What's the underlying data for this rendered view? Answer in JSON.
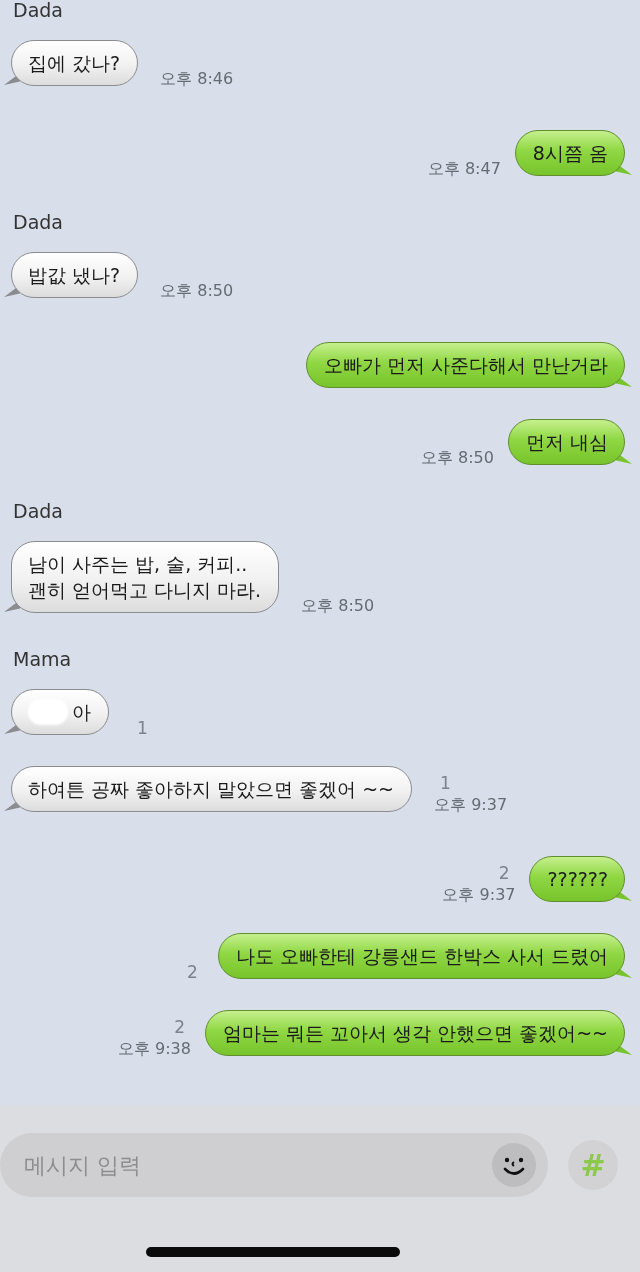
{
  "messages": [
    {
      "kind": "sender",
      "name": "Dada"
    },
    {
      "kind": "incoming",
      "text": "집에 갔나?",
      "time": "오후 8:46"
    },
    {
      "kind": "outgoing",
      "text": "8시쯤 옴",
      "time": "오후 8:47"
    },
    {
      "kind": "sender",
      "name": "Dada"
    },
    {
      "kind": "incoming",
      "text": "밥값 냈나?",
      "time": "오후 8:50"
    },
    {
      "kind": "outgoing",
      "text": "오빠가 먼저 사준다해서 만난거라"
    },
    {
      "kind": "outgoing",
      "text": "먼저 내심",
      "time": "오후 8:50"
    },
    {
      "kind": "sender",
      "name": "Dada"
    },
    {
      "kind": "incoming",
      "text": "남이 사주는 밥, 술, 커피..\n괜히 얻어먹고 다니지 마라.",
      "time": "오후 8:50"
    },
    {
      "kind": "sender",
      "name": "Mama"
    },
    {
      "kind": "incoming",
      "text": "아",
      "redacted_prefix": true,
      "unread": "1"
    },
    {
      "kind": "incoming",
      "text": "하여튼 공짜 좋아하지 말았으면 좋겠어 ~~",
      "unread": "1",
      "time": "오후 9:37"
    },
    {
      "kind": "outgoing",
      "text": "??????",
      "unread": "2",
      "time": "오후 9:37"
    },
    {
      "kind": "outgoing",
      "text": "나도 오빠한테 강릉샌드 한박스 사서 드렸어",
      "unread": "2"
    },
    {
      "kind": "outgoing",
      "text": "엄마는 뭐든 꼬아서 생각 안했으면 좋겠어~~",
      "unread": "2",
      "time": "오후 9:38"
    }
  ],
  "composer": {
    "placeholder": "메시지 입력",
    "hash_label": "#"
  }
}
